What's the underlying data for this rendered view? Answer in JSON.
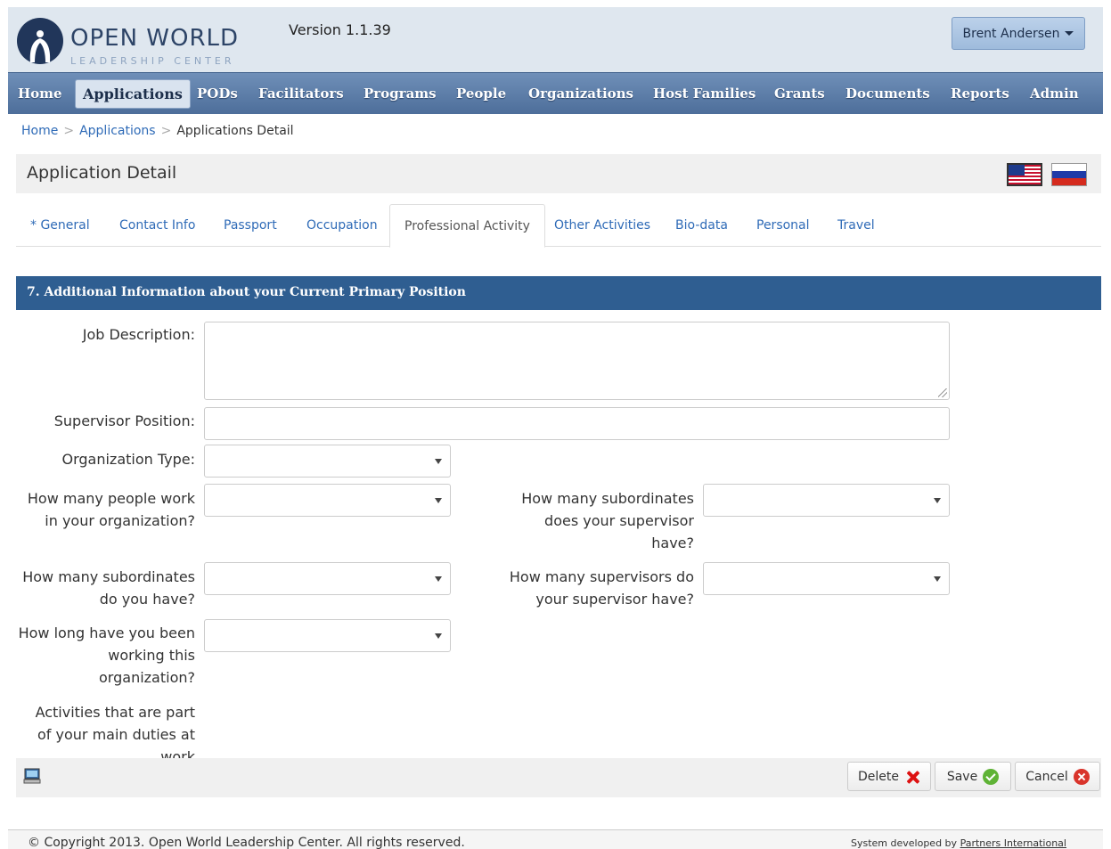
{
  "header": {
    "logo_title": "OPEN WORLD",
    "logo_subtitle": "LEADERSHIP CENTER",
    "version": "Version 1.1.39",
    "user_name": "Brent Andersen"
  },
  "nav": {
    "items": [
      {
        "label": "Home"
      },
      {
        "label": "Applications"
      },
      {
        "label": "PODs"
      },
      {
        "label": "Facilitators"
      },
      {
        "label": "Programs"
      },
      {
        "label": "People"
      },
      {
        "label": "Organizations"
      },
      {
        "label": "Host Families"
      },
      {
        "label": "Grants"
      },
      {
        "label": "Documents"
      },
      {
        "label": "Reports"
      },
      {
        "label": "Admin"
      }
    ],
    "active_index": 1
  },
  "breadcrumb": {
    "items": [
      "Home",
      "Applications"
    ],
    "current": "Applications Detail",
    "separator": ">"
  },
  "page": {
    "title": "Application Detail"
  },
  "tabs": [
    {
      "label": "* General"
    },
    {
      "label": "Contact Info"
    },
    {
      "label": "Passport"
    },
    {
      "label": "Occupation"
    },
    {
      "label": "Professional Activity"
    },
    {
      "label": "Other Activities"
    },
    {
      "label": "Bio-data"
    },
    {
      "label": "Personal"
    },
    {
      "label": "Travel"
    }
  ],
  "active_tab_index": 4,
  "section": {
    "title": "7. Additional Information about your Current Primary Position"
  },
  "form": {
    "job_description_label": "Job Description:",
    "job_description_value": "",
    "supervisor_position_label": "Supervisor Position:",
    "supervisor_position_value": "",
    "organization_type_label": "Organization Type:",
    "organization_type_value": "",
    "people_work_label": "How many people work in your organization?",
    "people_work_value": "",
    "supervisor_subordinates_label": "How many subordinates does your supervisor have?",
    "supervisor_subordinates_value": "",
    "your_subordinates_label": "How many subordinates do you have?",
    "your_subordinates_value": "",
    "supervisors_of_supervisor_label": "How many supervisors do your supervisor have?",
    "supervisors_of_supervisor_value": "",
    "how_long_label": "How long have you been working this organization?",
    "how_long_value": "",
    "activities_label": "Activities that are part of your main duties at work"
  },
  "toolbar": {
    "delete_label": "Delete",
    "save_label": "Save",
    "cancel_label": "Cancel"
  },
  "footer": {
    "copyright": "© Copyright 2013. Open World Leadership Center. All rights reserved.",
    "credit_prefix": "System developed by",
    "credit_link": "Partners International"
  },
  "colors": {
    "nav_bg": "#5a7ba6",
    "section_bg": "#2f5e91",
    "link": "#2f6bb7"
  },
  "icons": {
    "user_menu": "chevron-down-icon",
    "delete": "red-x-icon",
    "save": "green-check-icon",
    "cancel": "red-cancel-circle-icon",
    "toolbar_left": "computer-icon"
  }
}
